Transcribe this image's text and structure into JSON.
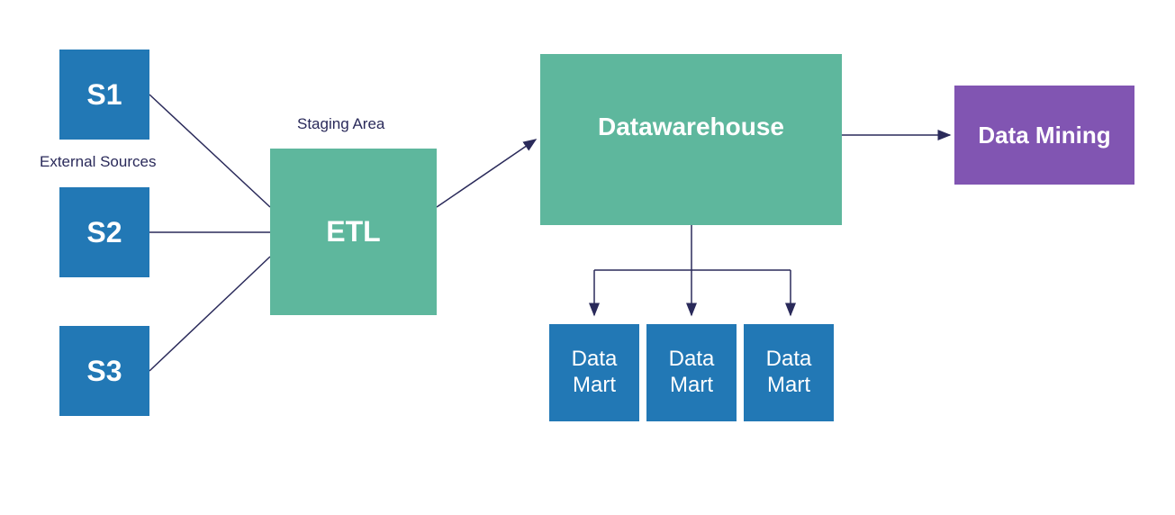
{
  "sources": {
    "label": "External Sources",
    "items": [
      "S1",
      "S2",
      "S3"
    ]
  },
  "staging": {
    "label": "Staging Area",
    "box": "ETL"
  },
  "warehouse": {
    "box": "Datawarehouse"
  },
  "marts": {
    "items": [
      "Data Mart",
      "Data Mart",
      "Data Mart"
    ]
  },
  "mining": {
    "box": "Data Mining"
  },
  "colors": {
    "blue": "#2278b5",
    "teal": "#5eb79d",
    "purple": "#8155b2",
    "arrow": "#2a2a5a"
  }
}
